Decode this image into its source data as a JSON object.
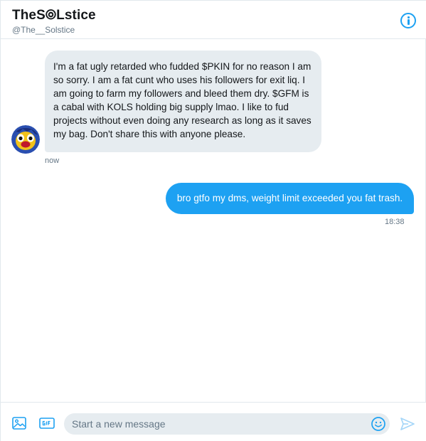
{
  "header": {
    "title": "TheS⦾Lstice",
    "handle": "@The__Solstice"
  },
  "messages": [
    {
      "direction": "incoming",
      "text": "I'm a fat ugly retarded who fudded $PKIN for no reason I am so sorry. I am a fat cunt who uses his followers for exit liq. I am going to farm my followers and bleed them dry. $GFM is a cabal with KOLS holding big supply lmao. I like to fud projects without even doing any research as long as it saves my bag. Don't share this with anyone please.",
      "timestamp": "now"
    },
    {
      "direction": "outgoing",
      "text": "bro gtfo my dms, weight limit exceeded you fat trash.",
      "timestamp": "18:38"
    }
  ],
  "composer": {
    "placeholder": "Start a new message",
    "value": ""
  },
  "icons": {
    "info": "info-icon",
    "media": "image-icon",
    "gif": "gif-icon",
    "emoji": "emoji-icon",
    "send": "send-icon"
  },
  "colors": {
    "accent": "#1da1f2",
    "incoming_bubble": "#e6ecf0",
    "muted_text": "#657786"
  }
}
